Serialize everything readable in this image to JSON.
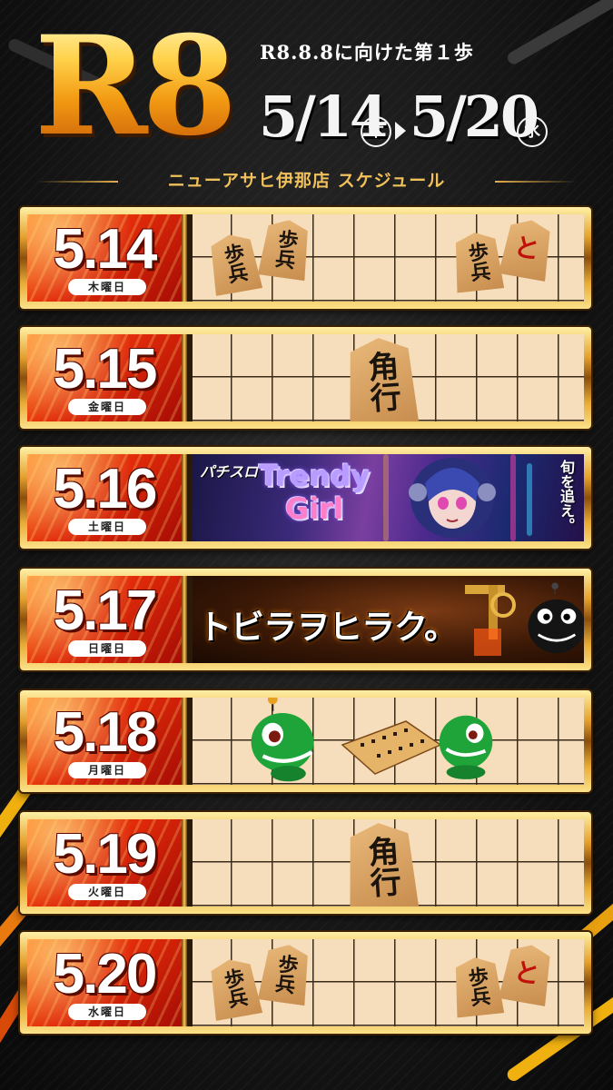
{
  "header": {
    "logo": "R8",
    "tagline": "R8.8.8に向けた第１歩",
    "start_date": "5/14",
    "start_dow": "木",
    "end_date": "5/20",
    "end_dow": "水",
    "store": "ニューアサヒ伊那店 スケジュール"
  },
  "colors": {
    "gold": "#e7b04a",
    "red": "#e12a0a",
    "board": "#f6ddbb"
  },
  "rows": [
    {
      "date": "5.14",
      "dow": "木曜日",
      "content": "shogi-board",
      "pieces": [
        "歩兵",
        "歩兵",
        "歩兵",
        "と"
      ]
    },
    {
      "date": "5.15",
      "dow": "金曜日",
      "content": "shogi-board",
      "pieces": [
        "角行"
      ]
    },
    {
      "date": "5.16",
      "dow": "土曜日",
      "content": "banner",
      "banner": {
        "brand": "パチスロ",
        "title_line1": "Trendy",
        "title_line2": "Girl",
        "vertical": "旬を追え。"
      }
    },
    {
      "date": "5.17",
      "dow": "日曜日",
      "content": "banner",
      "banner": {
        "title": "トビラヲヒラク。"
      }
    },
    {
      "date": "5.18",
      "dow": "月曜日",
      "content": "shogi-board",
      "pieces": []
    },
    {
      "date": "5.19",
      "dow": "火曜日",
      "content": "shogi-board",
      "pieces": [
        "角行"
      ]
    },
    {
      "date": "5.20",
      "dow": "水曜日",
      "content": "shogi-board",
      "pieces": [
        "歩兵",
        "歩兵",
        "歩兵",
        "と"
      ]
    }
  ]
}
